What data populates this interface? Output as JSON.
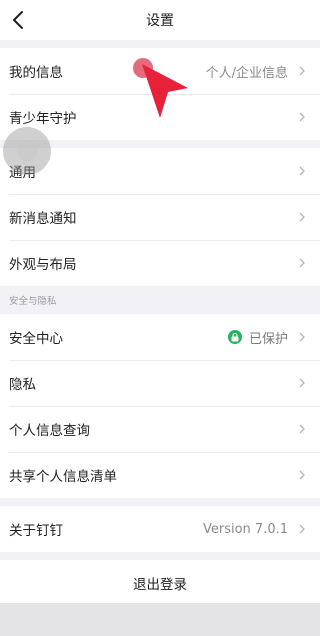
{
  "header": {
    "title": "设置"
  },
  "group1": {
    "items": [
      {
        "label": "我的信息",
        "value": "个人/企业信息"
      },
      {
        "label": "青少年守护"
      }
    ]
  },
  "group2": {
    "items": [
      {
        "label": "通用"
      },
      {
        "label": "新消息通知"
      },
      {
        "label": "外观与布局"
      }
    ]
  },
  "section_security": {
    "header": "安全与隐私"
  },
  "group3": {
    "items": [
      {
        "label": "安全中心",
        "status": "已保护"
      },
      {
        "label": "隐私"
      },
      {
        "label": "个人信息查询"
      },
      {
        "label": "共享个人信息清单"
      }
    ]
  },
  "group4": {
    "items": [
      {
        "label": "关于钉钉",
        "value": "Version 7.0.1"
      }
    ]
  },
  "logout": {
    "label": "退出登录"
  },
  "colors": {
    "accent_green": "#22b55d",
    "pointer_red": "#e8213a",
    "background": "#f2f2f6"
  }
}
